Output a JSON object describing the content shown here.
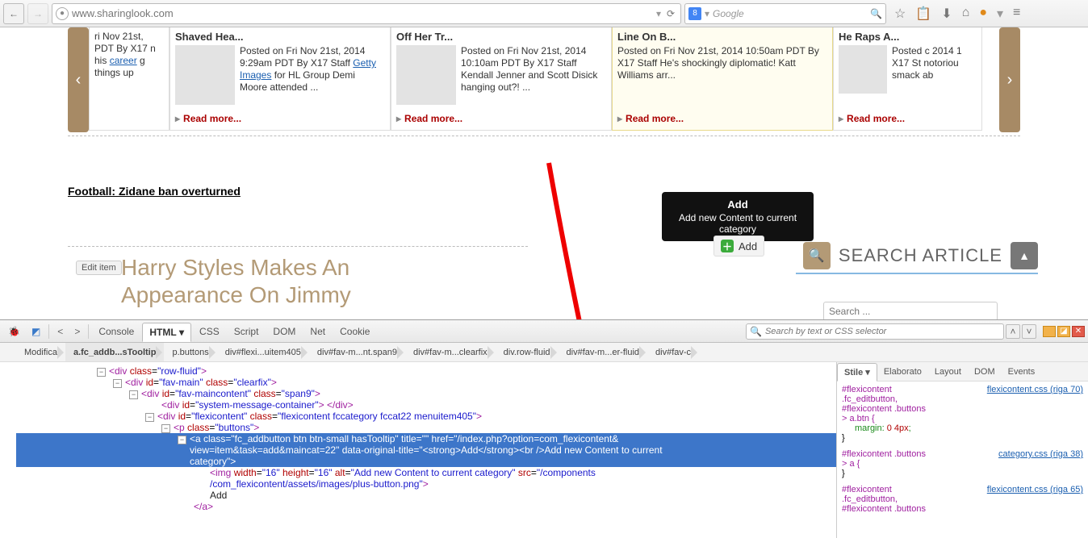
{
  "browser": {
    "url": "www.sharinglook.com",
    "reload_hint": "↻",
    "search_placeholder": "Google",
    "search_engine": "8",
    "dropdown": "▾"
  },
  "carousel": {
    "prev": "‹",
    "next": "›",
    "read_more": "Read more...",
    "cards": [
      {
        "title": "",
        "text_pre": "ri Nov 21st, PDT By X17 n his ",
        "link": "career",
        "text_post": " g things up"
      },
      {
        "title": "Shaved Hea...",
        "text_pre": "Posted on Fri Nov 21st, 2014 9:29am PDT By X17 Staff ",
        "link": "Getty Images",
        "text_post": " for HL Group Demi Moore attended ..."
      },
      {
        "title": "Off Her Tr...",
        "text": "Posted on Fri Nov 21st, 2014 10:10am PDT By X17 Staff Kendall Jenner and Scott Disick hanging out?! ..."
      },
      {
        "title": "Line On B...",
        "text": "Posted on Fri Nov 21st, 2014 10:50am PDT By X17 Staff He's shockingly diplomatic! Katt Williams arr..."
      },
      {
        "title": "He Raps A...",
        "text": "Posted c 2014 1 X17 St notoriou smack ab"
      }
    ]
  },
  "page": {
    "football": "Football: Zidane ban overturned",
    "edit_item": "Edit item",
    "main_title": "Harry Styles Makes An Appearance On Jimmy",
    "search_title": "SEARCH ARTICLE",
    "search_placeholder": "Search ...",
    "top_icon": "▲"
  },
  "tooltip": {
    "title": "Add",
    "body": "Add new Content to current category"
  },
  "addbtn": {
    "label": "Add"
  },
  "firebug": {
    "tabs": [
      "Console",
      "HTML",
      "CSS",
      "Script",
      "DOM",
      "Net",
      "Cookie"
    ],
    "active_tab": "HTML",
    "search_placeholder": "Search by text or CSS selector",
    "modifica": "Modifica",
    "crumbs": [
      "a.fc_addb...sTooltip",
      "p.buttons",
      "div#flexi...uitem405",
      "div#fav-m...nt.span9",
      "div#fav-m...clearfix",
      "div.row-fluid",
      "div#fav-m...er-fluid",
      "div#fav-c"
    ],
    "right_tabs": [
      "Stile",
      "Elaborato",
      "Layout",
      "DOM",
      "Events"
    ],
    "html": {
      "l1": "<div class=\"row-fluid\">",
      "l2": "<div id=\"fav-main\" class=\"clearfix\">",
      "l3": "<div id=\"fav-maincontent\" class=\"span9\">",
      "l4": "<div id=\"system-message-container\"> </div>",
      "l5": "<div id=\"flexicontent\" class=\"flexicontent fccategory fccat22 menuitem405\">",
      "l6": "<p class=\"buttons\">",
      "sel1": "<a class=\"fc_addbutton btn btn-small hasTooltip\" title=\"\" href=\"/index.php?option=com_flexicontent&",
      "sel2": "view=item&task=add&maincat=22\" data-original-title=\"<strong>Add</strong><br />Add new Content to current",
      "sel3": "category\">",
      "img1": "<img width=\"16\" height=\"16\" alt=\"Add new Content to current category\" src=\"/components",
      "img2": "/com_flexicontent/assets/images/plus-button.png\">",
      "addtxt": "Add",
      "close": "</a>"
    },
    "css": {
      "b1_src": "flexicontent.css (riga 70)",
      "b1_sel": "#flexicontent .fc_editbutton, #flexicontent .buttons > a.btn",
      "b1_prop": "margin",
      "b1_val": "0 4px",
      "b2_src": "category.css (riga 38)",
      "b2_sel": "#flexicontent .buttons > a",
      "b3_src": "flexicontent.css (riga 65)",
      "b3_sel": "#flexicontent .fc_editbutton, #flexicontent .buttons"
    }
  }
}
